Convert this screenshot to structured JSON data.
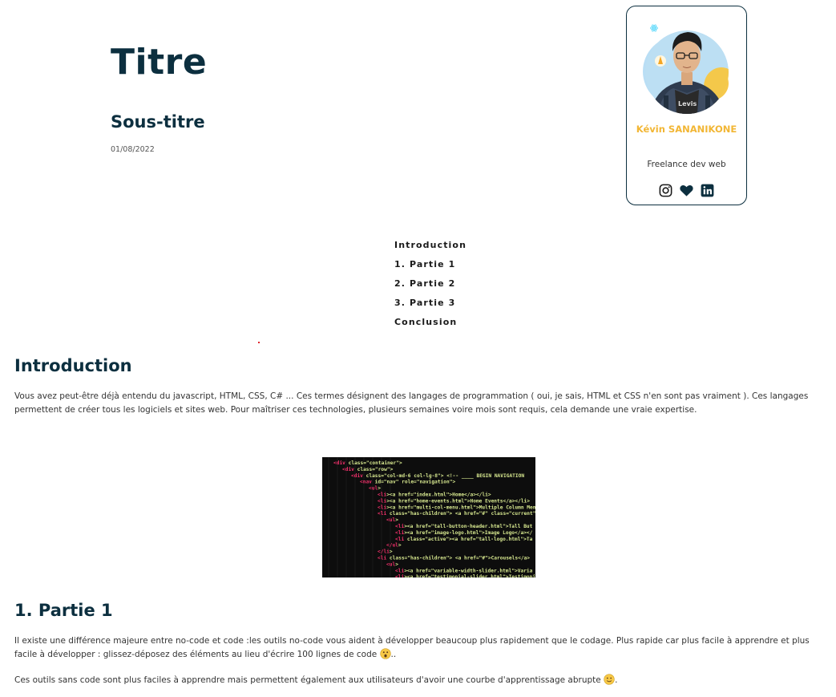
{
  "header": {
    "title": "Titre",
    "subtitle": "Sous-titre",
    "date": "01/08/2022"
  },
  "author_card": {
    "name": "Kévin SANANIKONE",
    "role": "Freelance dev web",
    "socials": [
      {
        "icon": "instagram-icon"
      },
      {
        "icon": "heart-icon"
      },
      {
        "icon": "linkedin-icon"
      }
    ],
    "colors": {
      "name": "#f2b634",
      "border": "#0c2f3f"
    }
  },
  "toc": {
    "items": [
      "Introduction",
      "1. Partie 1",
      "2. Partie 2",
      "3. Partie 3",
      "Conclusion"
    ]
  },
  "sections": {
    "intro": {
      "heading": "Introduction",
      "paragraph": "Vous avez peut-être déjà entendu du javascript, HTML, CSS, C# ... Ces termes désignent des langages de programmation ( oui, je sais, HTML et CSS n'en sont pas vraiment ). Ces langages permettent de créer tous les logiciels et sites web. Pour maîtriser ces technologies, plusieurs semaines voire mois sont requis, cela demande une vraie expertise."
    },
    "part1": {
      "heading": "1. Partie 1",
      "paragraph1": "Il existe une différence majeure entre no-code et code :les outils no-code vous aident à développer beaucoup plus rapidement que le codage. Plus rapide car plus facile à apprendre et plus facile à développer : glissez-déposez des éléments au lieu d'écrire 100 lignes de code",
      "paragraph1_end": "..",
      "paragraph2": "Ces outils sans code sont plus faciles à apprendre mais permettent également aux utilisateurs d'avoir une courbe d'apprentissage abrupte",
      "paragraph2_end": "."
    }
  },
  "code_image": {
    "lines": [
      {
        "indent": 0,
        "text": "<div class=\"container\">"
      },
      {
        "indent": 1,
        "text": "<div class=\"row\">"
      },
      {
        "indent": 2,
        "text": "<div class=\"col-md-6 col-lg-8\"> <!-- ____ BEGIN NAVIGATION"
      },
      {
        "indent": 3,
        "text": "<nav id=\"nav\" role=\"navigation\">"
      },
      {
        "indent": 4,
        "text": "<ul>"
      },
      {
        "indent": 5,
        "text": "<li><a href=\"index.html\">Home</a></li>"
      },
      {
        "indent": 5,
        "text": "<li><a href=\"home-events.html\">Home Events</a></li>"
      },
      {
        "indent": 5,
        "text": "<li><a href=\"multi-col-menu.html\">Multiple Column Men"
      },
      {
        "indent": 5,
        "text": "<li class=\"has-children\"> <a href=\"#\" class=\"current\""
      },
      {
        "indent": 6,
        "text": "<ul>"
      },
      {
        "indent": 7,
        "text": "<li><a href=\"tall-button-header.html\">Tall But"
      },
      {
        "indent": 7,
        "text": "<li><a href=\"image-logo.html\">Image Logo</a></"
      },
      {
        "indent": 7,
        "text": "<li class=\"active\"><a href=\"tall-logo.html\">Ta"
      },
      {
        "indent": 6,
        "text": "</ul>"
      },
      {
        "indent": 5,
        "text": "</li>"
      },
      {
        "indent": 5,
        "text": "<li class=\"has-children\"> <a href=\"#\">Carousels</a>"
      },
      {
        "indent": 6,
        "text": "<ul>"
      },
      {
        "indent": 7,
        "text": "<li><a href=\"variable-width-slider.html\">Varia"
      },
      {
        "indent": 7,
        "text": "<li><a href=\"testimonial-slider.html\">Testimoni"
      }
    ]
  }
}
